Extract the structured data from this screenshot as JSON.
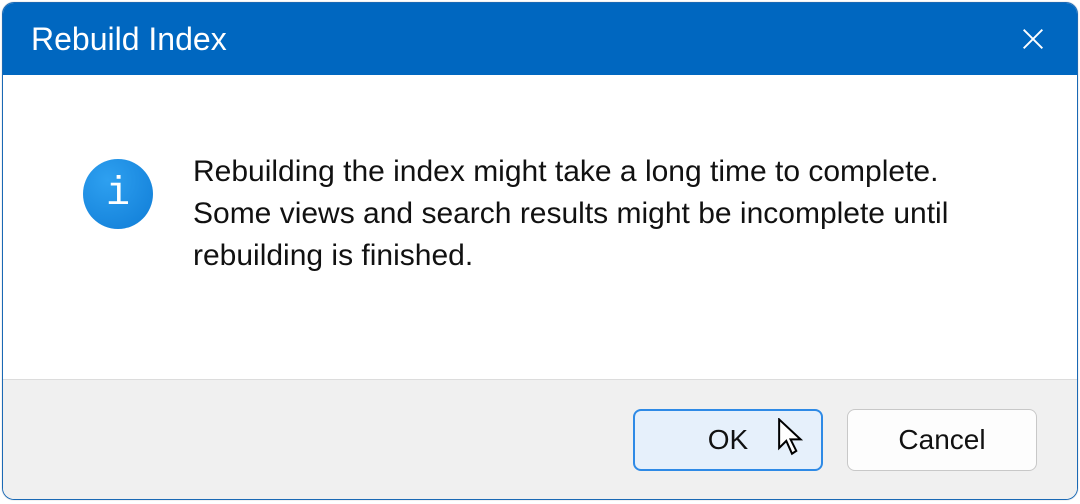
{
  "dialog": {
    "title": "Rebuild Index",
    "message": "Rebuilding the index might take a long time to complete. Some views and search results might be incomplete until rebuilding is finished.",
    "info_glyph": "i",
    "buttons": {
      "ok": "OK",
      "cancel": "Cancel"
    }
  }
}
